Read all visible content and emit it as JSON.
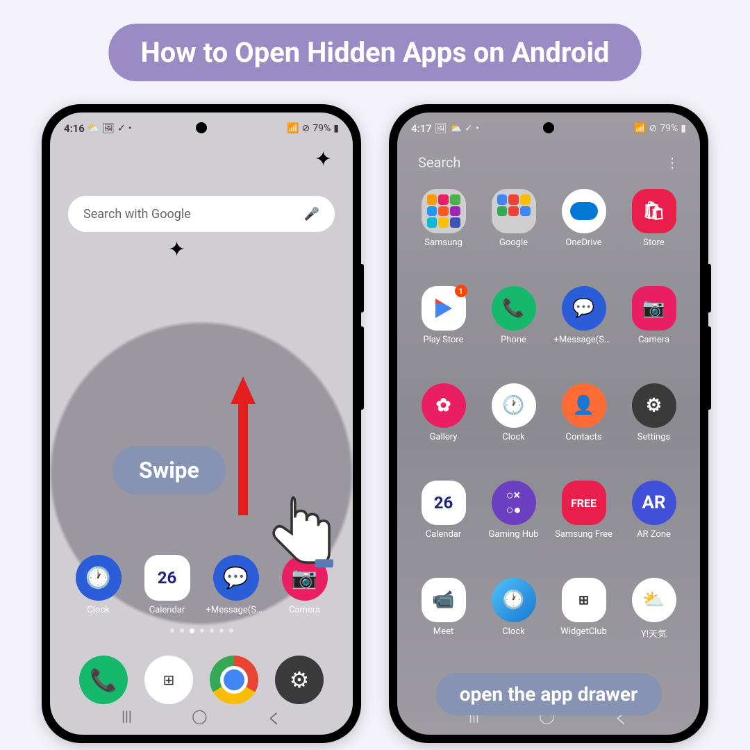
{
  "title": "How to Open Hidden Apps on Android",
  "swipe_label": "Swipe",
  "open_label": "open the app drawer",
  "phone_a": {
    "time": "4:16",
    "battery": "79%",
    "search_placeholder": "Search with Google",
    "home_row": [
      {
        "label": "Clock"
      },
      {
        "label": "Calendar",
        "num": "26"
      },
      {
        "label": "+Message(SM..."
      },
      {
        "label": "Camera"
      }
    ]
  },
  "phone_b": {
    "time": "4:17",
    "battery": "79%",
    "search_placeholder": "Search",
    "apps": [
      {
        "label": "Samsung",
        "type": "folder"
      },
      {
        "label": "Google",
        "type": "folder"
      },
      {
        "label": "OneDrive",
        "type": "cloud"
      },
      {
        "label": "Store",
        "type": "store"
      },
      {
        "label": "Play Store",
        "type": "play",
        "badge": "1"
      },
      {
        "label": "Phone",
        "type": "teal"
      },
      {
        "label": "+Message(SM...",
        "type": "blue"
      },
      {
        "label": "Camera",
        "type": "pink"
      },
      {
        "label": "Gallery",
        "type": "pink-flower"
      },
      {
        "label": "Clock",
        "type": "white-clock"
      },
      {
        "label": "Contacts",
        "type": "orange"
      },
      {
        "label": "Settings",
        "type": "dark"
      },
      {
        "label": "Calendar",
        "type": "cal",
        "num": "26"
      },
      {
        "label": "Gaming Hub",
        "type": "purple"
      },
      {
        "label": "Samsung Free",
        "type": "red-free"
      },
      {
        "label": "AR Zone",
        "type": "indigo-ar"
      },
      {
        "label": "Meet",
        "type": "meet"
      },
      {
        "label": "Clock",
        "type": "blue-clock"
      },
      {
        "label": "WidgetClub",
        "type": "widget"
      },
      {
        "label": "Y!天気",
        "type": "weather"
      }
    ]
  }
}
